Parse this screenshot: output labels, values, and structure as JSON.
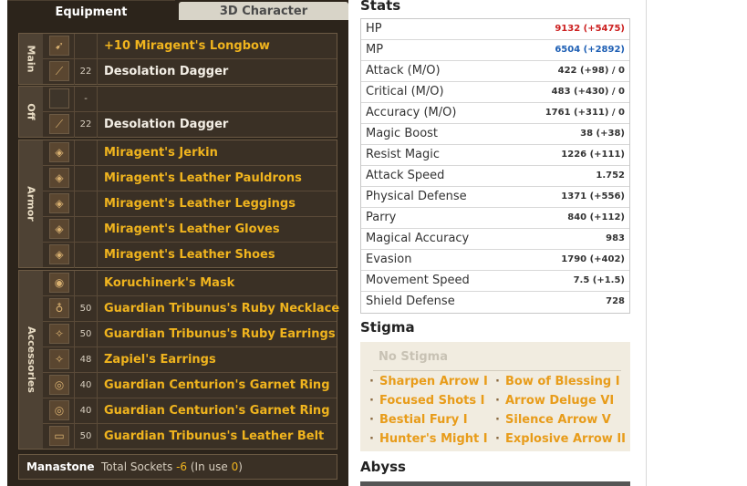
{
  "tabs": {
    "equipment": "Equipment",
    "character3d": "3D Character"
  },
  "groups": {
    "main": "Main",
    "off": "Off",
    "armor": "Armor",
    "accessories": "Accessories"
  },
  "items": {
    "main": [
      {
        "level": "",
        "name": "+10 Miragent's Longbow",
        "color": "gold",
        "icon": "bow-icon"
      },
      {
        "level": "22",
        "name": "Desolation Dagger",
        "color": "white",
        "icon": "dagger-icon"
      }
    ],
    "off": [
      {
        "level": "-",
        "name": "",
        "color": "white",
        "icon": "empty-slot-icon"
      },
      {
        "level": "22",
        "name": "Desolation Dagger",
        "color": "white",
        "icon": "dagger-icon"
      }
    ],
    "armor": [
      {
        "level": "",
        "name": "Miragent's Jerkin",
        "color": "gold",
        "icon": "jerkin-icon"
      },
      {
        "level": "",
        "name": "Miragent's Leather Pauldrons",
        "color": "gold",
        "icon": "pauldrons-icon"
      },
      {
        "level": "",
        "name": "Miragent's Leather Leggings",
        "color": "gold",
        "icon": "leggings-icon"
      },
      {
        "level": "",
        "name": "Miragent's Leather Gloves",
        "color": "gold",
        "icon": "gloves-icon"
      },
      {
        "level": "",
        "name": "Miragent's Leather Shoes",
        "color": "gold",
        "icon": "shoes-icon"
      }
    ],
    "accessories": [
      {
        "level": "",
        "name": "Koruchinerk's Mask",
        "color": "gold",
        "icon": "mask-icon"
      },
      {
        "level": "50",
        "name": "Guardian Tribunus's Ruby Necklace",
        "color": "gold",
        "icon": "necklace-icon"
      },
      {
        "level": "50",
        "name": "Guardian Tribunus's Ruby Earrings",
        "color": "gold",
        "icon": "earrings-icon"
      },
      {
        "level": "48",
        "name": "Zapiel's Earrings",
        "color": "gold",
        "icon": "earrings-icon"
      },
      {
        "level": "40",
        "name": "Guardian Centurion's Garnet Ring",
        "color": "gold",
        "icon": "ring-icon"
      },
      {
        "level": "40",
        "name": "Guardian Centurion's Garnet Ring",
        "color": "gold",
        "icon": "ring-icon"
      },
      {
        "level": "50",
        "name": "Guardian Tribunus's Leather Belt",
        "color": "gold",
        "icon": "belt-icon"
      }
    ]
  },
  "manastone": {
    "label": "Manastone",
    "text_prefix": "Total Sockets ",
    "sockets": "-6",
    "text_mid": " (In use ",
    "in_use": "0",
    "text_suffix": ")"
  },
  "stats": {
    "title": "Stats",
    "rows": [
      {
        "label": "HP",
        "value": "9132 (+5475)",
        "color": "#cc2020"
      },
      {
        "label": "MP",
        "value": "6504 (+2892)",
        "color": "#1e5fb4"
      },
      {
        "label": "Attack (M/O)",
        "value": "422 (+98) / 0",
        "color": "#333333"
      },
      {
        "label": "Critical (M/O)",
        "value": "483 (+430) / 0",
        "color": "#333333"
      },
      {
        "label": "Accuracy (M/O)",
        "value": "1761 (+311) / 0",
        "color": "#333333"
      },
      {
        "label": "Magic Boost",
        "value": "38 (+38)",
        "color": "#333333"
      },
      {
        "label": "Resist Magic",
        "value": "1226 (+111)",
        "color": "#333333"
      },
      {
        "label": "Attack Speed",
        "value": "1.752",
        "color": "#333333"
      },
      {
        "label": "Physical Defense",
        "value": "1371 (+556)",
        "color": "#333333"
      },
      {
        "label": "Parry",
        "value": "840 (+112)",
        "color": "#333333"
      },
      {
        "label": "Magical Accuracy",
        "value": "983",
        "color": "#333333"
      },
      {
        "label": "Evasion",
        "value": "1790 (+402)",
        "color": "#333333"
      },
      {
        "label": "Movement Speed",
        "value": "7.5 (+1.5)",
        "color": "#333333"
      },
      {
        "label": "Shield Defense",
        "value": "728",
        "color": "#333333"
      }
    ]
  },
  "stigma": {
    "title": "Stigma",
    "empty_label": "No Stigma",
    "left": [
      "Sharpen Arrow I",
      "Focused Shots I",
      "Bestial Fury I",
      "Hunter's Might I"
    ],
    "right": [
      "Bow of Blessing I",
      "Arrow Deluge VI",
      "Silence Arrow V",
      "Explosive Arrow II"
    ]
  },
  "abyss": {
    "title": "Abyss"
  }
}
